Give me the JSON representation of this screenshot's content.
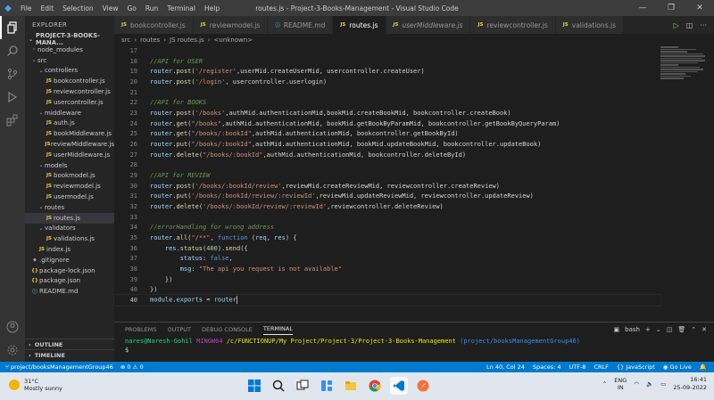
{
  "titlebar": {
    "menu": [
      "File",
      "Edit",
      "Selection",
      "View",
      "Go",
      "Run",
      "Terminal",
      "Help"
    ],
    "title": "routes.js - Project-3-Books-Management - Visual Studio Code"
  },
  "sidebar": {
    "header": "EXPLORER",
    "project": "PROJECT-3-BOOKS-MANA...",
    "tree": [
      {
        "label": "node_modules",
        "type": "folder",
        "depth": 0,
        "open": false
      },
      {
        "label": "src",
        "type": "folder",
        "depth": 0,
        "open": true
      },
      {
        "label": "controllers",
        "type": "folder",
        "depth": 1,
        "open": true
      },
      {
        "label": "bookcontroller.js",
        "type": "js",
        "depth": 2
      },
      {
        "label": "reviewcontroller.js",
        "type": "js",
        "depth": 2
      },
      {
        "label": "usercontroller.js",
        "type": "js",
        "depth": 2
      },
      {
        "label": "middleware",
        "type": "folder",
        "depth": 1,
        "open": true
      },
      {
        "label": "auth.js",
        "type": "js",
        "depth": 2
      },
      {
        "label": "bookMiddleware.js",
        "type": "js",
        "depth": 2
      },
      {
        "label": "reviewMiddleware.js",
        "type": "js",
        "depth": 2
      },
      {
        "label": "userMiddleware.js",
        "type": "js",
        "depth": 2
      },
      {
        "label": "models",
        "type": "folder",
        "depth": 1,
        "open": true
      },
      {
        "label": "bookmodel.js",
        "type": "js",
        "depth": 2
      },
      {
        "label": "reviewmodel.js",
        "type": "js",
        "depth": 2
      },
      {
        "label": "usermodel.js",
        "type": "js",
        "depth": 2
      },
      {
        "label": "routes",
        "type": "folder",
        "depth": 1,
        "open": true
      },
      {
        "label": "routes.js",
        "type": "js",
        "depth": 2,
        "selected": true
      },
      {
        "label": "validators",
        "type": "folder",
        "depth": 1,
        "open": true
      },
      {
        "label": "validations.js",
        "type": "js",
        "depth": 2
      },
      {
        "label": "index.js",
        "type": "js",
        "depth": 1
      },
      {
        "label": ".gitignore",
        "type": "git",
        "depth": 0
      },
      {
        "label": "package-lock.json",
        "type": "json",
        "depth": 0
      },
      {
        "label": "package.json",
        "type": "json",
        "depth": 0
      },
      {
        "label": "README.md",
        "type": "md",
        "depth": 0
      }
    ],
    "outline": "OUTLINE",
    "timeline": "TIMELINE"
  },
  "tabs": [
    {
      "label": "bookcontroller.js",
      "icon": "JS",
      "active": false,
      "italic": false
    },
    {
      "label": "reviewmodel.js",
      "icon": "JS",
      "active": false,
      "italic": false
    },
    {
      "label": "README.md",
      "icon": "ⓘ",
      "active": false,
      "italic": false
    },
    {
      "label": "routes.js",
      "icon": "JS",
      "active": true,
      "italic": false
    },
    {
      "label": "userMiddleware.js",
      "icon": "JS",
      "active": false,
      "italic": true
    },
    {
      "label": "reviewcontroller.js",
      "icon": "JS",
      "active": false,
      "italic": false
    },
    {
      "label": "validations.js",
      "icon": "JS",
      "active": false,
      "italic": false
    }
  ],
  "breadcrumb": [
    "src",
    "routes",
    "JS routes.js",
    "<unknown>"
  ],
  "editor": {
    "current_line": 40,
    "lines": [
      {
        "n": 17,
        "t": [
          [
            "",
            ""
          ]
        ]
      },
      {
        "n": 18,
        "t": [
          [
            "c",
            "//API for USER"
          ]
        ]
      },
      {
        "n": 19,
        "t": [
          [
            "v",
            "router"
          ],
          [
            "p",
            "."
          ],
          [
            "f",
            "post"
          ],
          [
            "p",
            "("
          ],
          [
            "s",
            "'/register'"
          ],
          [
            "p",
            ",userMid.createUserMid, usercontroller.createUser)"
          ]
        ]
      },
      {
        "n": 20,
        "t": [
          [
            "v",
            "router"
          ],
          [
            "p",
            "."
          ],
          [
            "f",
            "post"
          ],
          [
            "p",
            "("
          ],
          [
            "s",
            "'/login'"
          ],
          [
            "p",
            ", usercontroller.userlogin)"
          ]
        ]
      },
      {
        "n": 21,
        "t": [
          [
            "",
            ""
          ]
        ]
      },
      {
        "n": 22,
        "t": [
          [
            "c",
            "//API for BOOKS"
          ]
        ]
      },
      {
        "n": 23,
        "t": [
          [
            "v",
            "router"
          ],
          [
            "p",
            "."
          ],
          [
            "f",
            "post"
          ],
          [
            "p",
            "("
          ],
          [
            "s",
            "'/books'"
          ],
          [
            "p",
            ",authMid.authenticationMid,bookMid.createBookMid, bookcontroller.createBook)"
          ]
        ]
      },
      {
        "n": 24,
        "t": [
          [
            "v",
            "router"
          ],
          [
            "p",
            "."
          ],
          [
            "f",
            "get"
          ],
          [
            "p",
            "("
          ],
          [
            "s",
            "\"/books\""
          ],
          [
            "p",
            ",authMid.authenticationMid, bookMid.getBookByParamMid, bookcontroller.getBookByQueryParam)"
          ]
        ]
      },
      {
        "n": 25,
        "t": [
          [
            "v",
            "router"
          ],
          [
            "p",
            "."
          ],
          [
            "f",
            "get"
          ],
          [
            "p",
            "("
          ],
          [
            "s",
            "\"/books/:bookId\""
          ],
          [
            "p",
            ",authMid.authenticationMid, bookcontroller.getBookById)"
          ]
        ]
      },
      {
        "n": 26,
        "t": [
          [
            "v",
            "router"
          ],
          [
            "p",
            "."
          ],
          [
            "f",
            "put"
          ],
          [
            "p",
            "("
          ],
          [
            "s",
            "\"/books/:bookId\""
          ],
          [
            "p",
            ",authMid.authenticationMid, bookMid.updateBookMid, bookcontroller.updateBook)"
          ]
        ]
      },
      {
        "n": 27,
        "t": [
          [
            "v",
            "router"
          ],
          [
            "p",
            "."
          ],
          [
            "f",
            "delete"
          ],
          [
            "p",
            "("
          ],
          [
            "s",
            "\"/books/:bookId\""
          ],
          [
            "p",
            ",authMid.authenticationMid, bookcontroller.deleteById)"
          ]
        ]
      },
      {
        "n": 28,
        "t": [
          [
            "",
            ""
          ]
        ]
      },
      {
        "n": 29,
        "t": [
          [
            "c",
            "//API for REVIEW"
          ]
        ]
      },
      {
        "n": 30,
        "t": [
          [
            "v",
            "router"
          ],
          [
            "p",
            "."
          ],
          [
            "f",
            "post"
          ],
          [
            "p",
            "("
          ],
          [
            "s",
            "'/books/:bookId/review'"
          ],
          [
            "p",
            ",reviewMid.createReviewMid, reviewcontroller.createReview)"
          ]
        ]
      },
      {
        "n": 31,
        "t": [
          [
            "v",
            "router"
          ],
          [
            "p",
            "."
          ],
          [
            "f",
            "put"
          ],
          [
            "p",
            "("
          ],
          [
            "s",
            "'/books/:bookId/review/:reviewId'"
          ],
          [
            "p",
            ",reviewMid.updateReviewMid, reviewcontroller.updateReview)"
          ]
        ]
      },
      {
        "n": 32,
        "t": [
          [
            "v",
            "router"
          ],
          [
            "p",
            "."
          ],
          [
            "f",
            "delete"
          ],
          [
            "p",
            "("
          ],
          [
            "s",
            "'/books/:bookId/review/:reviewId'"
          ],
          [
            "p",
            ",reviewcontroller.deleteReview)"
          ]
        ]
      },
      {
        "n": 33,
        "t": [
          [
            "",
            ""
          ]
        ]
      },
      {
        "n": 34,
        "t": [
          [
            "c",
            "//errorHandling for wrong address"
          ]
        ]
      },
      {
        "n": 35,
        "t": [
          [
            "v",
            "router"
          ],
          [
            "p",
            "."
          ],
          [
            "f",
            "all"
          ],
          [
            "p",
            "("
          ],
          [
            "s",
            "\"/**\""
          ],
          [
            "p",
            ", "
          ],
          [
            "k",
            "function"
          ],
          [
            "p",
            " ("
          ],
          [
            "v",
            "req"
          ],
          [
            "p",
            ", "
          ],
          [
            "v",
            "res"
          ],
          [
            "p",
            ") {"
          ]
        ]
      },
      {
        "n": 36,
        "t": [
          [
            "p",
            "    "
          ],
          [
            "v",
            "res"
          ],
          [
            "p",
            "."
          ],
          [
            "f",
            "status"
          ],
          [
            "p",
            "("
          ],
          [
            "n",
            "400"
          ],
          [
            "p",
            ")."
          ],
          [
            "f",
            "send"
          ],
          [
            "p",
            "({"
          ]
        ]
      },
      {
        "n": 37,
        "t": [
          [
            "p",
            "        "
          ],
          [
            "v",
            "status"
          ],
          [
            "p",
            ": "
          ],
          [
            "k",
            "false"
          ],
          [
            "p",
            ","
          ]
        ]
      },
      {
        "n": 38,
        "t": [
          [
            "p",
            "        "
          ],
          [
            "v",
            "msg"
          ],
          [
            "p",
            ": "
          ],
          [
            "s",
            "\"The api you request is not available\""
          ]
        ]
      },
      {
        "n": 39,
        "t": [
          [
            "p",
            "    })"
          ]
        ]
      },
      {
        "n": 40,
        "t": [
          [
            "p",
            "})"
          ]
        ]
      },
      {
        "n": 40,
        "t": [
          [
            "v",
            "module"
          ],
          [
            "p",
            "."
          ],
          [
            "v",
            "exports"
          ],
          [
            "p",
            " = "
          ],
          [
            "v",
            "router"
          ]
        ]
      }
    ]
  },
  "panel": {
    "tabs": [
      "PROBLEMS",
      "OUTPUT",
      "DEBUG CONSOLE",
      "TERMINAL"
    ],
    "active_tab": "TERMINAL",
    "shell": "bash",
    "terminal": {
      "user": "nares@Naresh-Gohil",
      "mingw": "MINGW64",
      "path": "/c/FUNCTIONUP/My Project/Project-3/Project-3-Books-Management",
      "branch": "(project/booksManagementGroup46)",
      "prompt": "$"
    }
  },
  "statusbar": {
    "branch": "project/booksManagementGroup46",
    "errors": "0",
    "warnings": "0",
    "position": "Ln 40, Col 24",
    "spaces": "Spaces: 4",
    "encoding": "UTF-8",
    "eol": "CRLF",
    "language": "{} JavaScript",
    "golive": "Go Live"
  },
  "taskbar": {
    "temp": "31°C",
    "weather": "Mostly sunny",
    "lang_top": "ENG",
    "lang_bottom": "IN",
    "time": "16:41",
    "date": "25-09-2022"
  }
}
